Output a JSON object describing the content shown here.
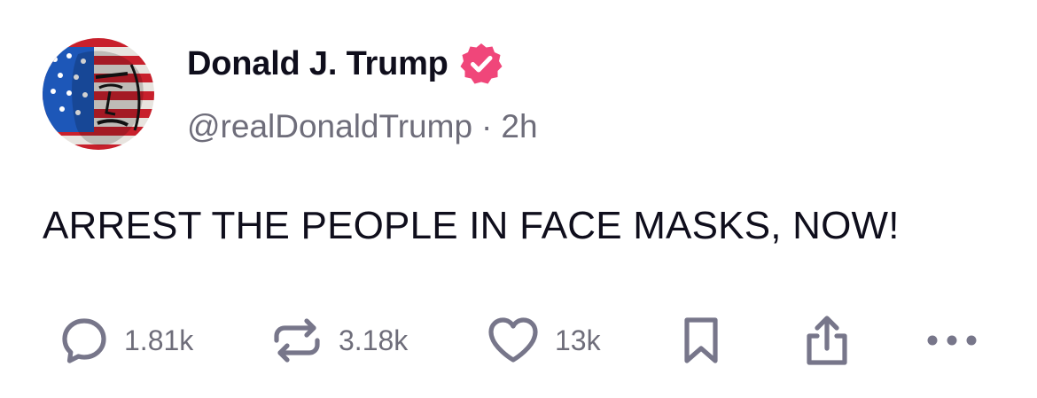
{
  "author": {
    "display_name": "Donald J. Trump",
    "handle": "@realDonaldTrump",
    "separator": "·",
    "time": "2h",
    "verified_badge_color": "#f0467a"
  },
  "post": {
    "text": "ARREST THE PEOPLE IN FACE MASKS, NOW!"
  },
  "actions": {
    "reply_count": "1.81k",
    "retweet_count": "3.18k",
    "like_count": "13k",
    "icons": [
      "reply-icon",
      "retweet-icon",
      "like-icon",
      "bookmark-icon",
      "share-icon",
      "more-icon"
    ]
  },
  "colors": {
    "text_primary": "#0f0e1c",
    "text_secondary": "#6e6d7a",
    "icon_gray": "#77768a"
  }
}
